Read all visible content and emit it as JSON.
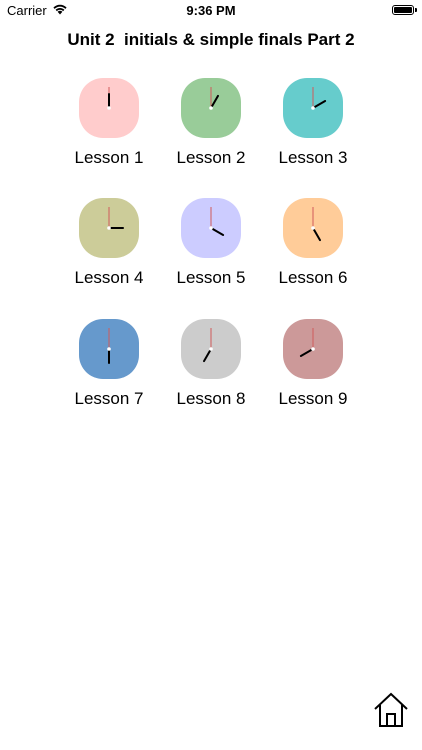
{
  "status_bar": {
    "carrier": "Carrier",
    "time": "9:36 PM",
    "icons": [
      "wifi-icon",
      "battery-icon"
    ]
  },
  "title": "Unit 2  initials & simple finals Part 2",
  "lessons": [
    {
      "label": "Lesson 1",
      "color": "#ffcccc",
      "time": "12:00"
    },
    {
      "label": "Lesson 2",
      "color": "#99cc99",
      "time": "1:00"
    },
    {
      "label": "Lesson 3",
      "color": "#66cccc",
      "time": "2:00"
    },
    {
      "label": "Lesson 4",
      "color": "#cccc99",
      "time": "3:00"
    },
    {
      "label": "Lesson 5",
      "color": "#ccccff",
      "time": "4:00"
    },
    {
      "label": "Lesson 6",
      "color": "#ffcc99",
      "time": "5:00"
    },
    {
      "label": "Lesson 7",
      "color": "#6699cc",
      "time": "6:00"
    },
    {
      "label": "Lesson 8",
      "color": "#cccccc",
      "time": "7:00"
    },
    {
      "label": "Lesson 9",
      "color": "#cc9999",
      "time": "8:00"
    }
  ],
  "home": {
    "icon": "home-icon"
  }
}
